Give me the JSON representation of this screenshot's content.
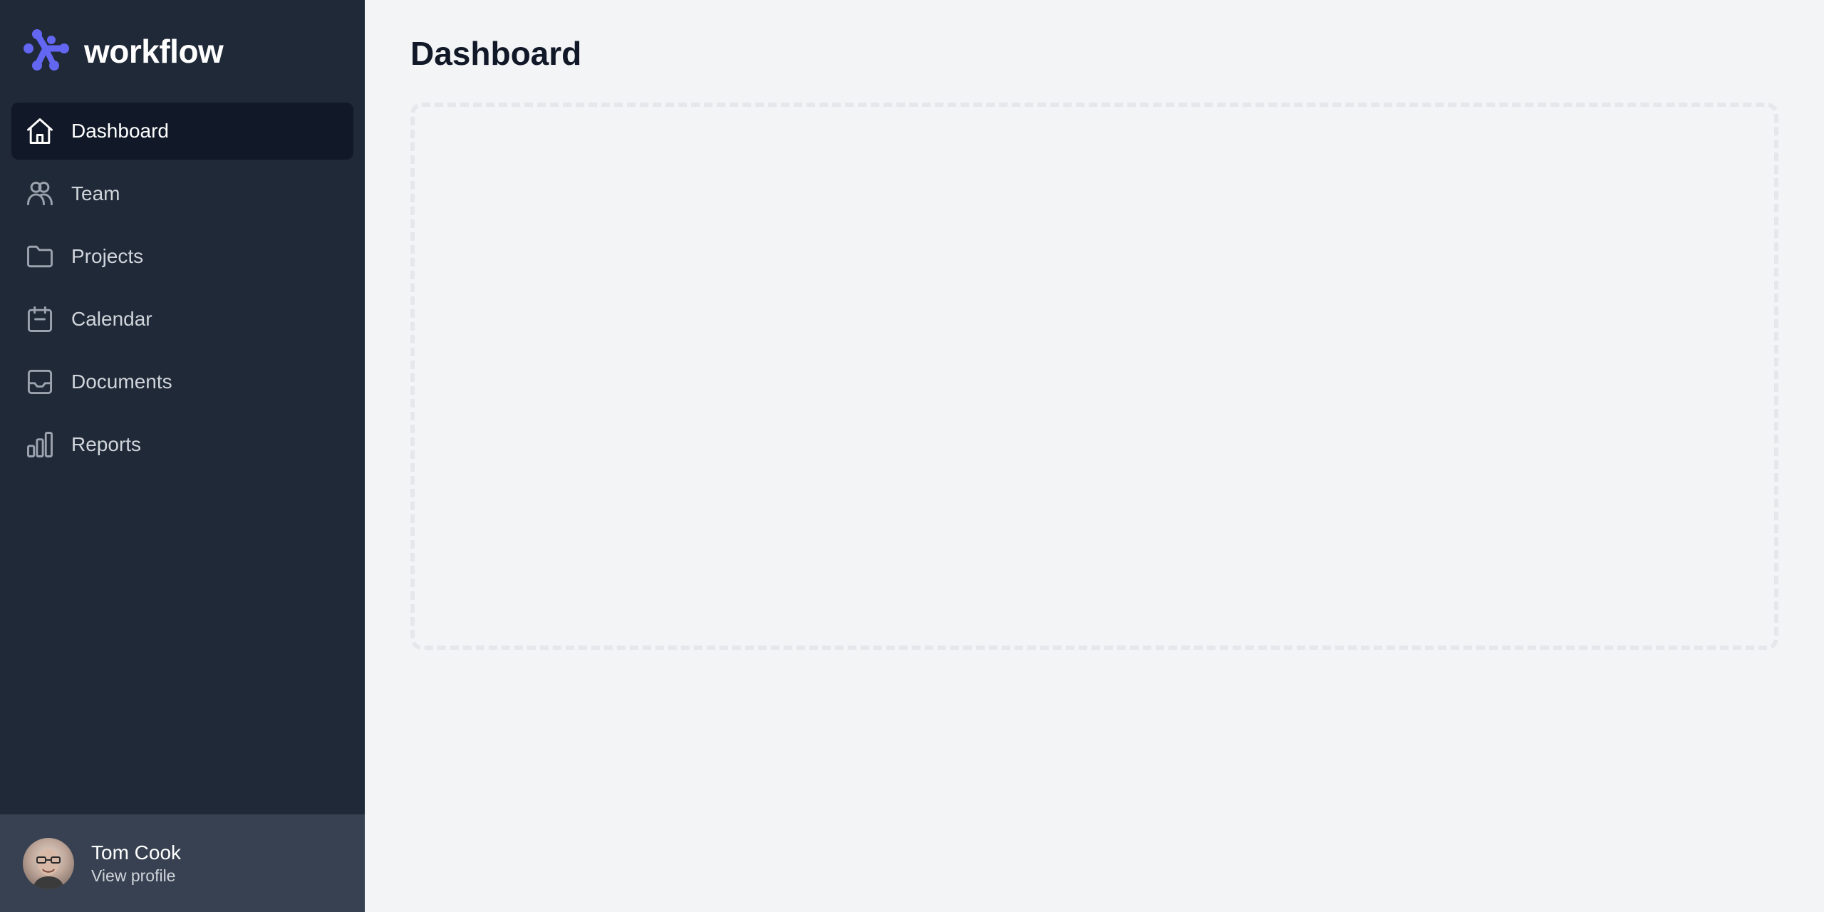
{
  "brand": {
    "name": "workflow",
    "accent": "#6366f1"
  },
  "nav": [
    {
      "label": "Dashboard",
      "icon": "home-icon",
      "active": true
    },
    {
      "label": "Team",
      "icon": "users-icon",
      "active": false
    },
    {
      "label": "Projects",
      "icon": "folder-icon",
      "active": false
    },
    {
      "label": "Calendar",
      "icon": "calendar-icon",
      "active": false
    },
    {
      "label": "Documents",
      "icon": "inbox-icon",
      "active": false
    },
    {
      "label": "Reports",
      "icon": "chart-bar-icon",
      "active": false
    }
  ],
  "profile": {
    "name": "Tom Cook",
    "link": "View profile"
  },
  "main": {
    "title": "Dashboard"
  },
  "colors": {
    "sidebar": "#1f2937",
    "active_item": "#111827",
    "profile_bg": "#374151",
    "page_bg": "#f3f4f6"
  }
}
